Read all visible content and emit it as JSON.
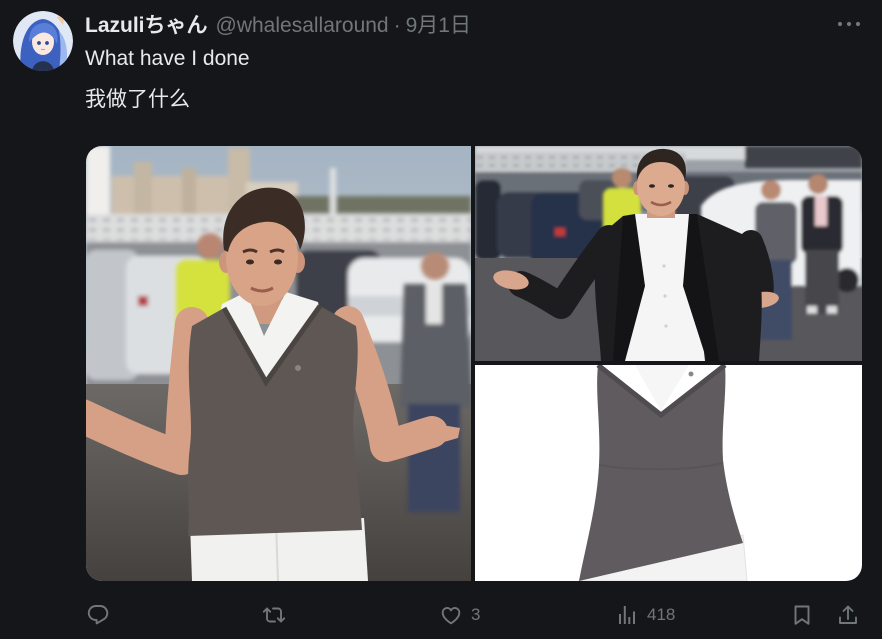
{
  "theme": {
    "background": "#15161a",
    "text": "#e7e9ea",
    "secondary_text": "#71767b"
  },
  "author": {
    "display_name": "Lazuliちゃん",
    "handle": "@whalesallaround"
  },
  "meta": {
    "separator": "·",
    "date": "9月1日",
    "more_icon": "more-horizontal-icon"
  },
  "tweet": {
    "text": [
      "What have I done",
      "我做了什么"
    ]
  },
  "actions": {
    "reply": {
      "icon": "reply-icon"
    },
    "retweet": {
      "icon": "retweet-icon"
    },
    "like": {
      "icon": "heart-icon",
      "count": "3"
    },
    "views": {
      "icon": "views-icon",
      "count": "418"
    },
    "bookmark": {
      "icon": "bookmark-icon"
    },
    "share": {
      "icon": "share-icon"
    }
  }
}
